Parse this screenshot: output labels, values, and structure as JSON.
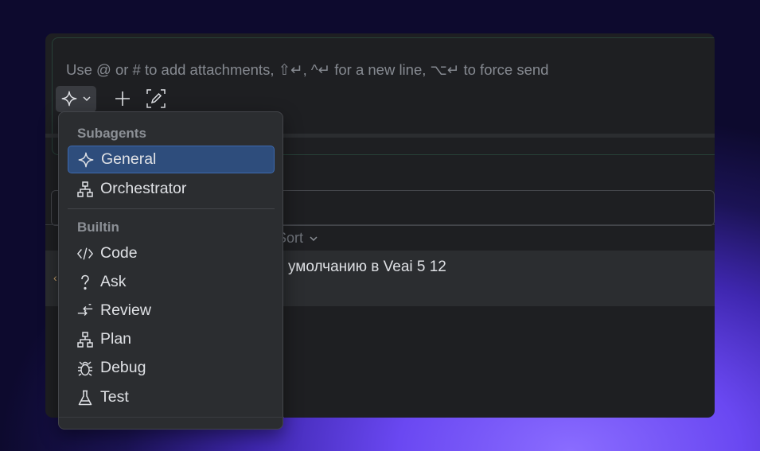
{
  "input": {
    "placeholder": "Use @ or # to add attachments, ⇧↵, ^↵ for a new line, ⌥↵ to force send"
  },
  "toolbar": {
    "mode_icon": "sparkle-icon",
    "dropdown_icon": "chevron-down-icon",
    "add_icon": "plus-icon",
    "screenshot_icon": "screenshot-edit-icon"
  },
  "background": {
    "sort_label": "Sort",
    "row_text": "умолчанию в Veai 5 12"
  },
  "menu": {
    "sections": [
      {
        "title": "Subagents"
      },
      {
        "title": "Builtin"
      }
    ],
    "items": [
      {
        "label": "General",
        "icon": "sparkle-icon",
        "selected": true
      },
      {
        "label": "Orchestrator",
        "icon": "hierarchy-icon"
      },
      {
        "label": "Code",
        "icon": "code-icon"
      },
      {
        "label": "Ask",
        "icon": "question-icon"
      },
      {
        "label": "Review",
        "icon": "review-arrows-icon"
      },
      {
        "label": "Plan",
        "icon": "hierarchy-icon"
      },
      {
        "label": "Debug",
        "icon": "bug-icon"
      },
      {
        "label": "Test",
        "icon": "flask-icon"
      }
    ]
  },
  "colors": {
    "accent_selected": "#2e4d7c",
    "panel": "#2b2d30",
    "editor_bg": "#1e1f22"
  }
}
